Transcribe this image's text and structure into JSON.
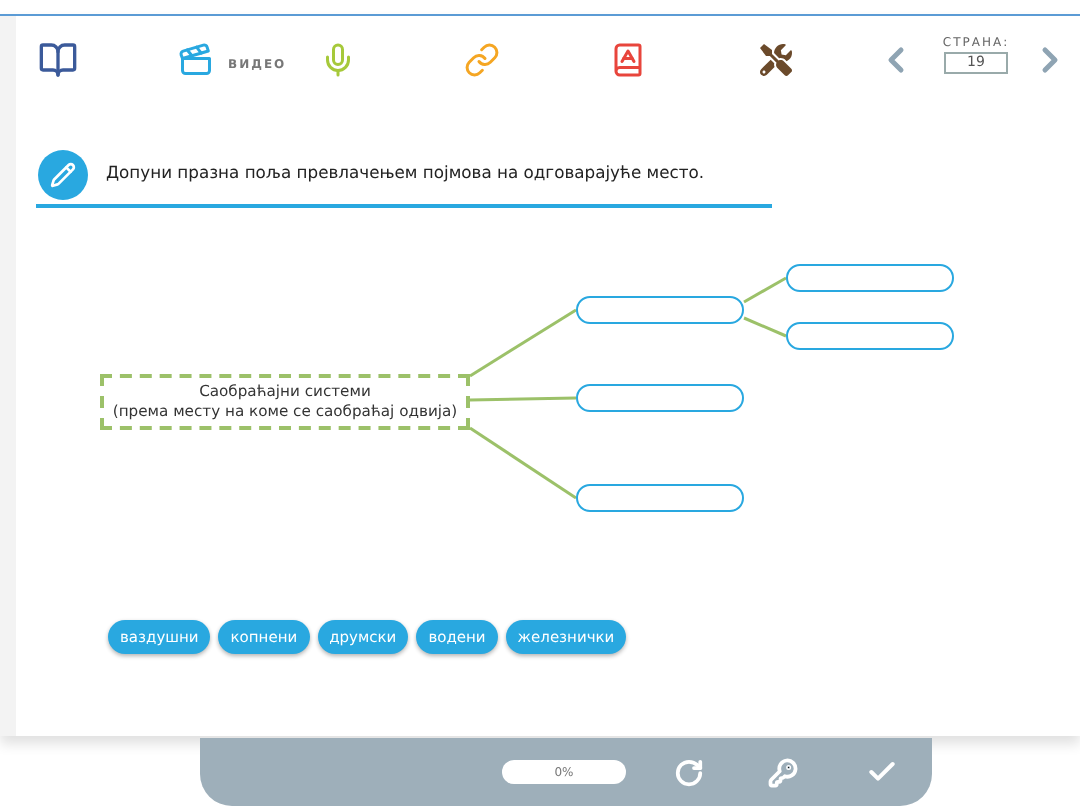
{
  "toolbar": {
    "video_label": "ВИДЕО",
    "page": {
      "label": "СТРАНА:",
      "value": "19"
    }
  },
  "instruction": "Допуни празна поља превлачењем појмова на одговарајуће место.",
  "diagram": {
    "root": "Саобраћајни системи\n(према месту на коме се саобраћај одвија)",
    "branches": [
      {
        "kind": "blank",
        "children": [
          {
            "kind": "blank"
          },
          {
            "kind": "blank"
          }
        ]
      },
      {
        "kind": "blank"
      },
      {
        "kind": "blank"
      }
    ]
  },
  "terms": [
    "ваздушни",
    "копнени",
    "друмски",
    "водени",
    "железнички"
  ],
  "footer": {
    "progress": {
      "label": "0%"
    }
  }
}
